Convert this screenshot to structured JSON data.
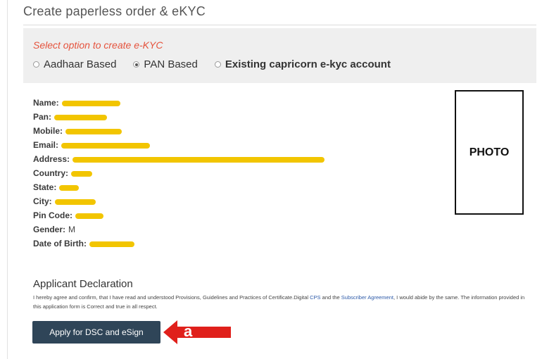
{
  "page": {
    "title": "Create paperless order & eKYC"
  },
  "option_panel": {
    "prompt": "Select option to create e-KYC",
    "options": [
      {
        "label": "Aadhaar Based",
        "selected": false
      },
      {
        "label": "PAN Based",
        "selected": true
      },
      {
        "label": "Existing capricorn e-kyc account",
        "selected": false
      }
    ]
  },
  "details": {
    "name_label": "Name:",
    "pan_label": "Pan:",
    "mobile_label": "Mobile:",
    "email_label": "Email:",
    "address_label": "Address:",
    "country_label": "Country:",
    "state_label": "State:",
    "city_label": "City:",
    "pin_label": "Pin Code:",
    "gender_label": "Gender:",
    "gender_value": "M",
    "dob_label": "Date of Birth:"
  },
  "photo": {
    "label": "PHOTO"
  },
  "declaration": {
    "title": "Applicant Declaration",
    "text_part1": "I hereby agree and confirm, that I have read and understood Provisions, Guidelines and Practices of Certificate.Digital ",
    "link_cps": "CPS",
    "text_part2": " and the ",
    "link_agreement": "Subscriber Agreement",
    "text_part3": ", I would abide by the same. The information provided in this application form is Correct and true in all respect."
  },
  "apply_button": {
    "label": "Apply for DSC and eSign"
  },
  "annotation": {
    "marker": "a",
    "color": "#e0201b"
  },
  "colors": {
    "prompt": "#e5533d",
    "button": "#2f4558",
    "redaction": "#f2c500",
    "panel": "#efefef"
  }
}
